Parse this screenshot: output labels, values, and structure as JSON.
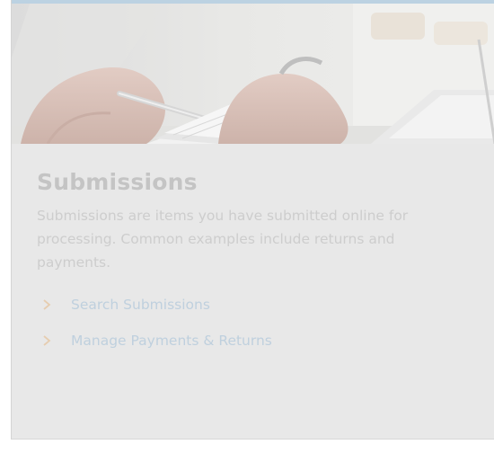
{
  "panel": {
    "title": "Submissions",
    "description": "Submissions are items you have submitted online for processing. Common examples include returns and payments.",
    "links": [
      {
        "label": "Search Submissions",
        "icon": "chevron-right-icon"
      },
      {
        "label": "Manage Payments & Returns",
        "icon": "chevron-right-icon"
      }
    ]
  },
  "colors": {
    "panel_background": "#e8e8e8",
    "title": "#c4c4c4",
    "description": "#cdcdcd",
    "link": "#bfd0de",
    "chevron": "#e6cdb0",
    "accent_bar": "#bcd2e2"
  }
}
